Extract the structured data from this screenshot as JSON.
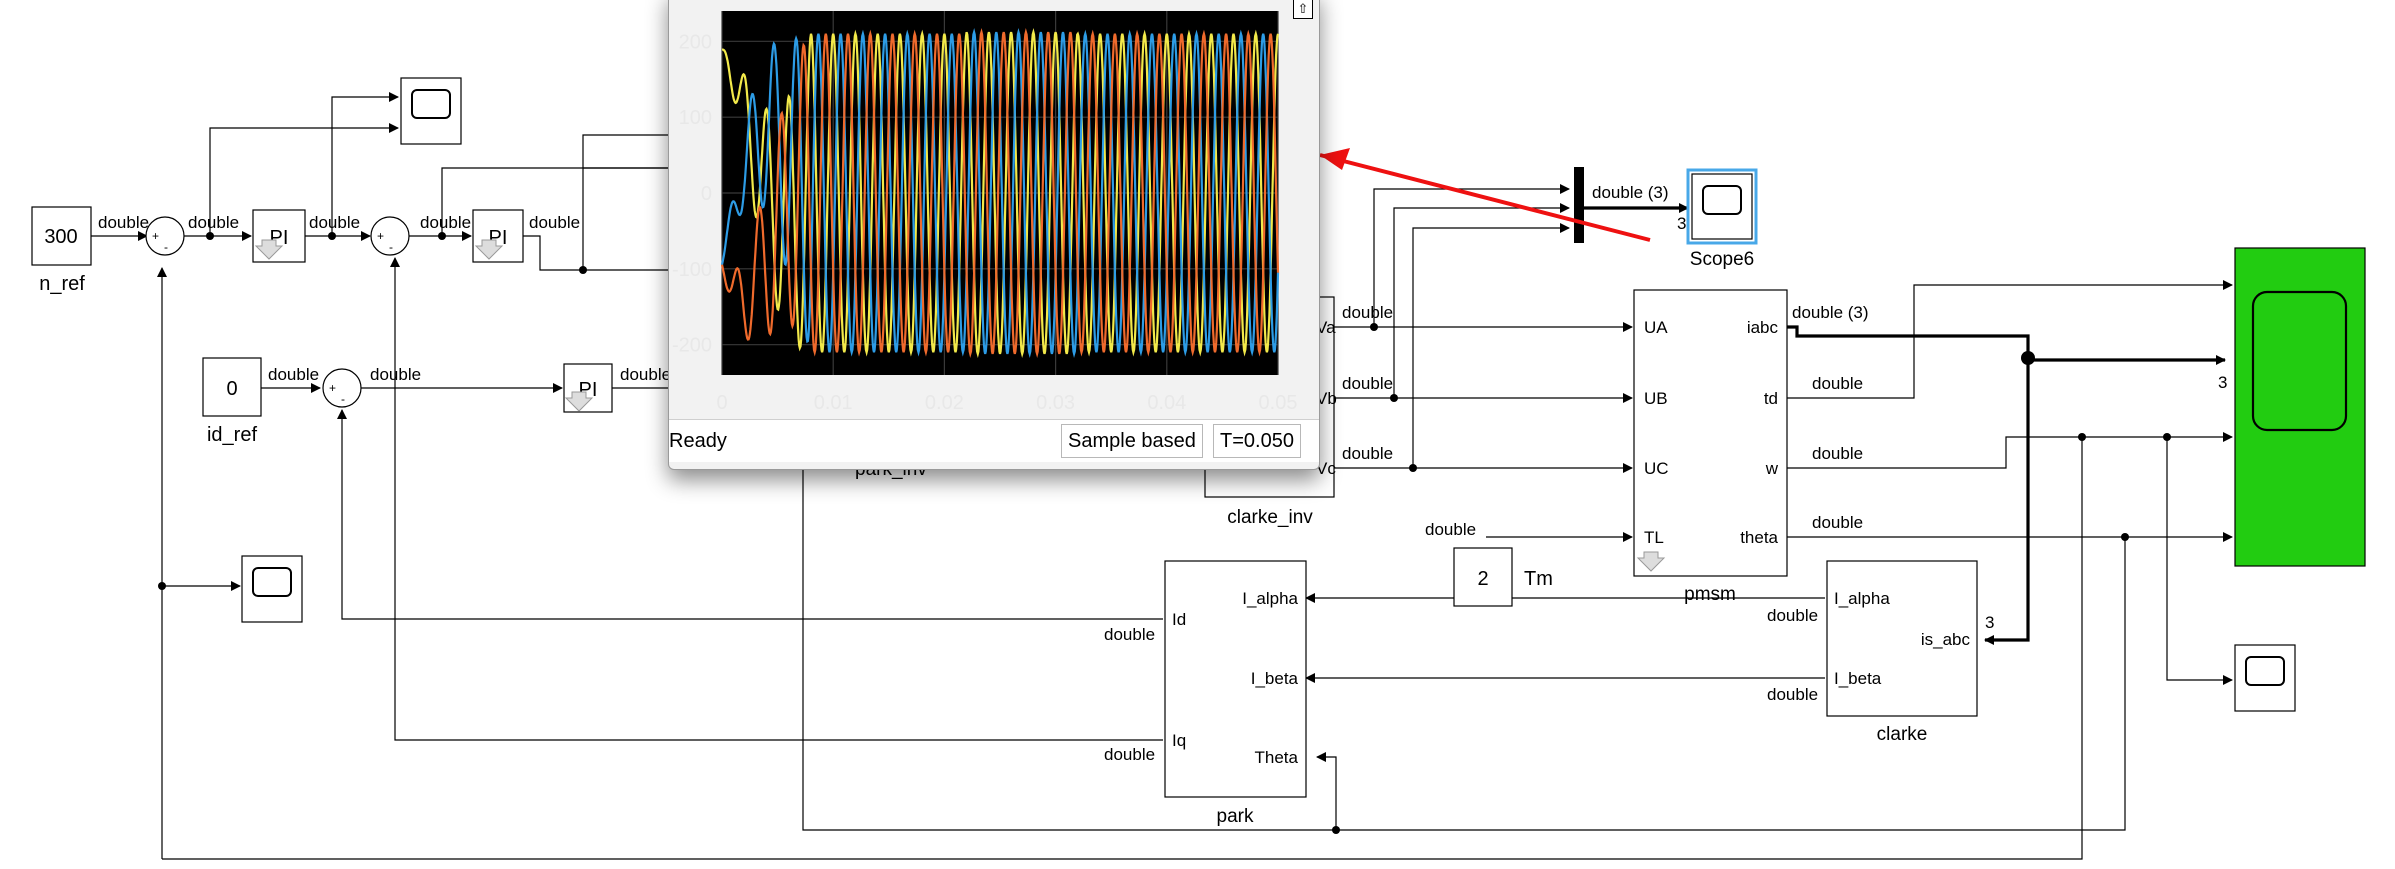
{
  "diagram": {
    "n_ref": {
      "value": "300",
      "name": "n_ref"
    },
    "id_ref": {
      "value": "0",
      "name": "id_ref"
    },
    "tm": {
      "value": "2",
      "name": "Tm"
    },
    "pi_label": "PI",
    "plus": "+",
    "minus": "-",
    "signal_double": "double",
    "signal_double3": "double (3)",
    "bus_width": "3",
    "scope6_name": "Scope6",
    "park": {
      "name": "park",
      "ports_in": [
        "Id",
        "Iq"
      ],
      "ports_out": [
        "I_alpha",
        "I_beta",
        "Theta"
      ]
    },
    "park_inv_name": "park_inv",
    "clarke_inv_name": "clarke_inv",
    "clarke_inv_ports": [
      "Va",
      "Vb",
      "Vc"
    ],
    "pmsm": {
      "name": "pmsm",
      "ports_in": [
        "UA",
        "UB",
        "UC",
        "TL"
      ],
      "ports_out": [
        "iabc",
        "td",
        "w",
        "theta"
      ]
    },
    "clarke": {
      "name": "clarke",
      "ports_in": [
        "I_alpha",
        "I_beta"
      ],
      "port_out": "is_abc"
    },
    "colors": {
      "green_scope": "#22cc11",
      "selection": "#48a8e8",
      "red_arrow": "#ee1111"
    }
  },
  "scope_window": {
    "status": "Ready",
    "sample_mode": "Sample based",
    "time": "T=0.050",
    "y_ticks": [
      "200",
      "100",
      "0",
      "-100",
      "-200"
    ],
    "x_ticks": [
      "0",
      "0.01",
      "0.02",
      "0.03",
      "0.04",
      "0.05"
    ],
    "chart_data": {
      "type": "line",
      "xlim": [
        0,
        0.05
      ],
      "ylim": [
        -240,
        240
      ],
      "grid": true,
      "series": [
        {
          "color": "#f2e94a",
          "phase_deg": 0
        },
        {
          "color": "#2d9ce6",
          "phase_deg": -120
        },
        {
          "color": "#ef6a2c",
          "phase_deg": 120
        }
      ],
      "waveform": {
        "steady_amplitude": 210,
        "frequency_hz": 500
      }
    }
  }
}
